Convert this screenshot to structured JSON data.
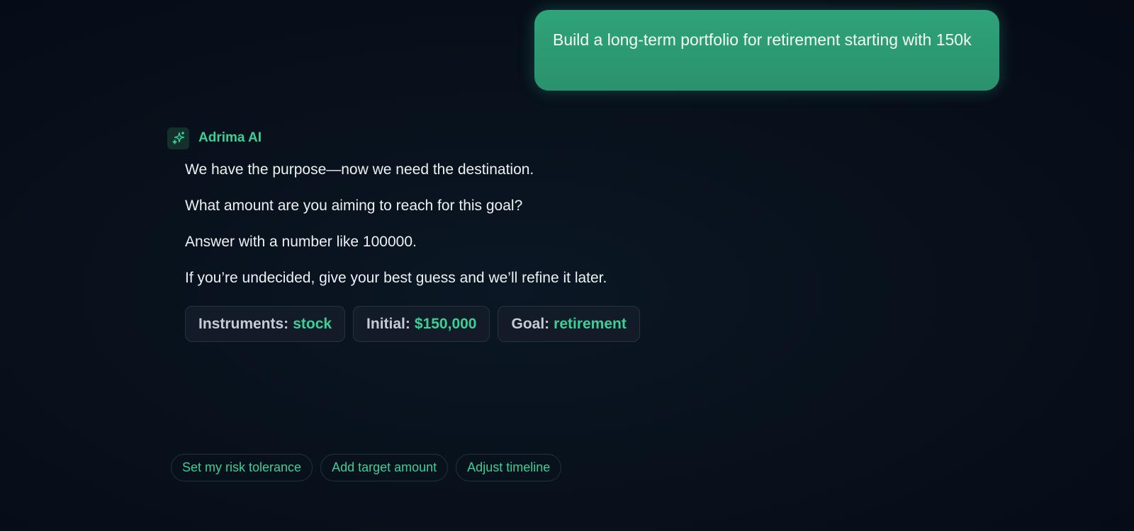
{
  "user_message": {
    "text": "Build a long-term portfolio for retirement starting with 150k"
  },
  "assistant": {
    "name": "Adrima AI",
    "avatar_icon": "sparkles-icon",
    "lines": [
      "We have the purpose—now we need the destination.",
      "What amount are you aiming to reach for this goal?",
      "Answer with a number like 100000.",
      "If you’re undecided, give your best guess and we’ll refine it later."
    ],
    "chips": [
      {
        "label": "Instruments:",
        "value": "stock"
      },
      {
        "label": "Initial:",
        "value": "$150,000"
      },
      {
        "label": "Goal:",
        "value": "retirement"
      }
    ]
  },
  "suggestions": [
    "Set my risk tolerance",
    "Add target amount",
    "Adjust timeline"
  ],
  "colors": {
    "accent": "#3ecf96",
    "user_bubble": "#2fa37a",
    "background": "#060b16"
  }
}
